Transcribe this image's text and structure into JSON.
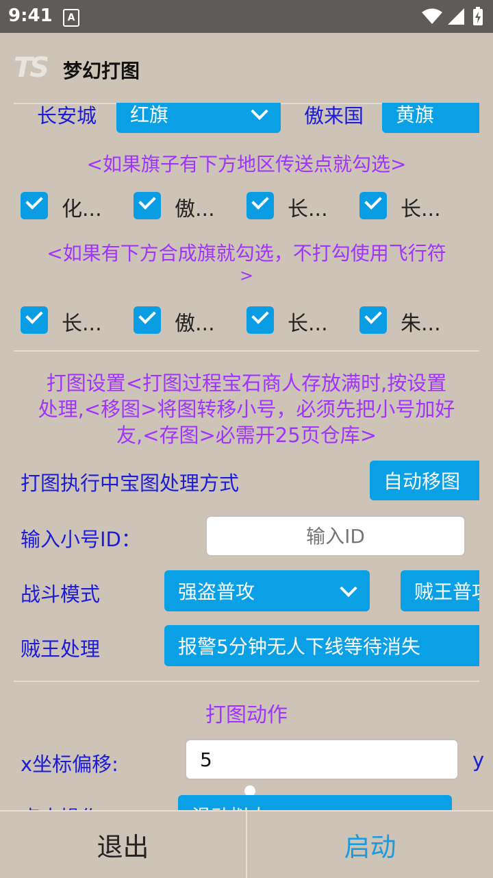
{
  "status": {
    "time": "9:41",
    "notification_icon": "A"
  },
  "app": {
    "title": "梦幻打图",
    "logo_text": "TS"
  },
  "flags": {
    "city1_label": "长安城",
    "city1_value": "红旗",
    "city2_label": "傲来国",
    "city2_value": "黄旗"
  },
  "section1": {
    "hint": "<如果旗子有下方地区传送点就勾选>"
  },
  "checkboxes_row1": [
    {
      "label": "化...",
      "checked": true
    },
    {
      "label": "傲...",
      "checked": true
    },
    {
      "label": "长...",
      "checked": true
    },
    {
      "label": "长...",
      "checked": true
    }
  ],
  "section2": {
    "hint_line1": "<如果有下方合成旗就勾选，不打勾使用飞行符",
    "hint_line2": ">"
  },
  "checkboxes_row2": [
    {
      "label": "长...",
      "checked": true
    },
    {
      "label": "傲...",
      "checked": true
    },
    {
      "label": "长...",
      "checked": true
    },
    {
      "label": "朱...",
      "checked": true
    }
  ],
  "settings": {
    "desc_line1": "打图设置<打图过程宝石商人存放满时,按设置",
    "desc_line2": "处理,<移图>将图转移小号，必须先把小号加好",
    "desc_line3": "友,<存图>必需开25页仓库>",
    "treasure_label": "打图执行中宝图处理方式",
    "treasure_value": "自动移图",
    "alt_id_label": "输入小号ID：",
    "alt_id_placeholder": "输入ID",
    "battle_label": "战斗模式",
    "battle_value": "强盗普攻",
    "battle_value2": "贼王普攻",
    "boss_label": "贼王处理",
    "boss_value": "报警5分钟无人下线等待消失"
  },
  "action": {
    "title": "打图动作",
    "x_offset_label": "x坐标偏移:",
    "x_offset_value": "5",
    "y_offset_label_partial": "y",
    "click_op_label_partial": "点击操作",
    "click_op_value_partial": "滑动拟人"
  },
  "buttons": {
    "exit": "退出",
    "start": "启动"
  },
  "colors": {
    "accent": "#09a0e6",
    "blue_text": "#1b1bd8",
    "purple_text": "#a033ff",
    "background": "#cdc3b6"
  }
}
